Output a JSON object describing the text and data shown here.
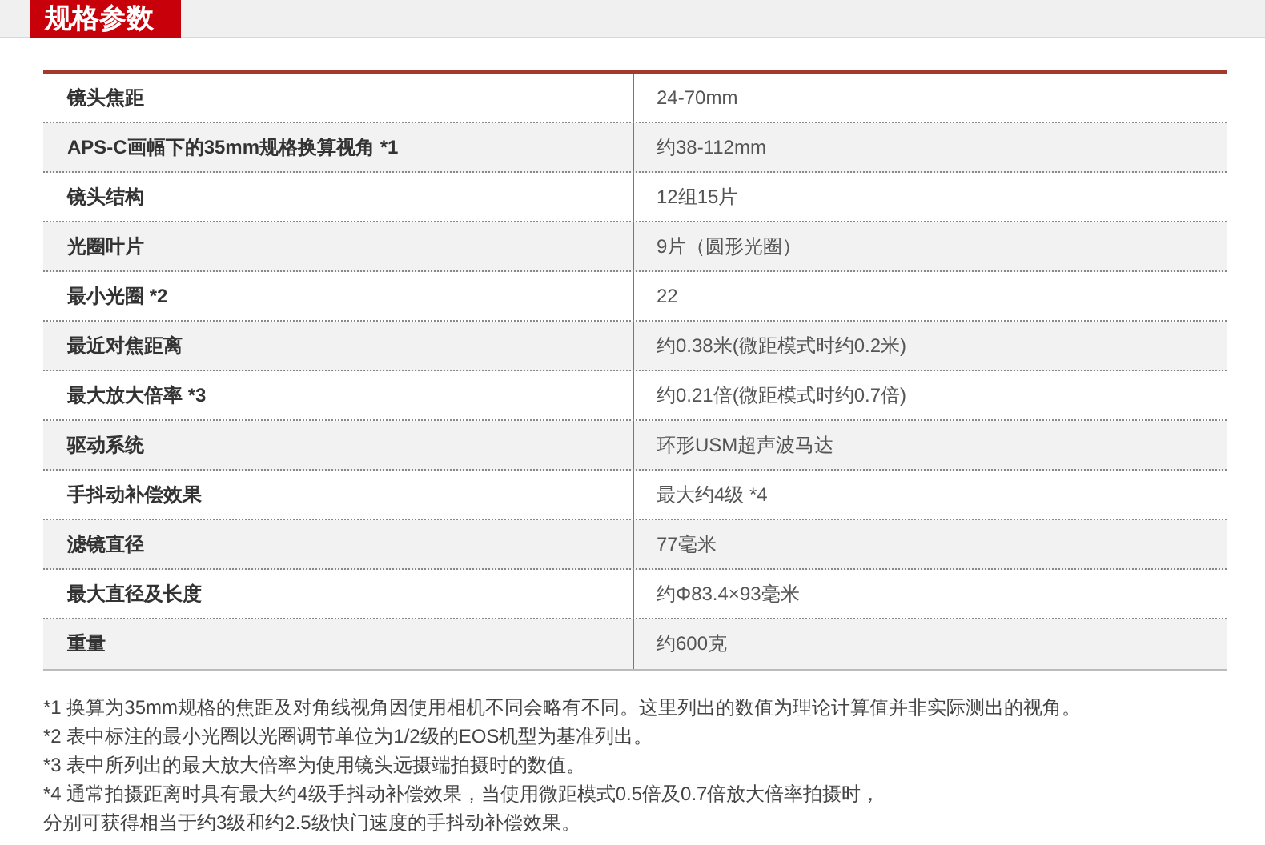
{
  "header": {
    "title": "规格参数"
  },
  "specs": [
    {
      "name": "镜头焦距",
      "value": "24-70mm"
    },
    {
      "name": "APS-C画幅下的35mm规格换算视角 *1",
      "value": "约38-112mm"
    },
    {
      "name": "镜头结构",
      "value": "12组15片"
    },
    {
      "name": "光圈叶片",
      "value": "9片（圆形光圈）"
    },
    {
      "name": "最小光圈 *2",
      "value": "22"
    },
    {
      "name": "最近对焦距离",
      "value": "约0.38米(微距模式时约0.2米)"
    },
    {
      "name": "最大放大倍率 *3",
      "value": "约0.21倍(微距模式时约0.7倍)"
    },
    {
      "name": "驱动系统",
      "value": "环形USM超声波马达"
    },
    {
      "name": "手抖动补偿效果",
      "value": "最大约4级 *4"
    },
    {
      "name": "滤镜直径",
      "value": "77毫米"
    },
    {
      "name": "最大直径及长度",
      "value": "约Φ83.4×93毫米"
    },
    {
      "name": "重量",
      "value": "约600克"
    }
  ],
  "notes": [
    "*1 换算为35mm规格的焦距及对角线视角因使用相机不同会略有不同。这里列出的数值为理论计算值并非实际测出的视角。",
    "*2 表中标注的最小光圈以光圈调节单位为1/2级的EOS机型为基准列出。",
    "*3 表中所列出的最大放大倍率为使用镜头远摄端拍摄时的数值。",
    "*4 通常拍摄距离时具有最大约4级手抖动补偿效果，当使用微距模式0.5倍及0.7倍放大倍率拍摄时，",
    "分别可获得相当于约3级和约2.5级快门速度的手抖动补偿效果。"
  ]
}
